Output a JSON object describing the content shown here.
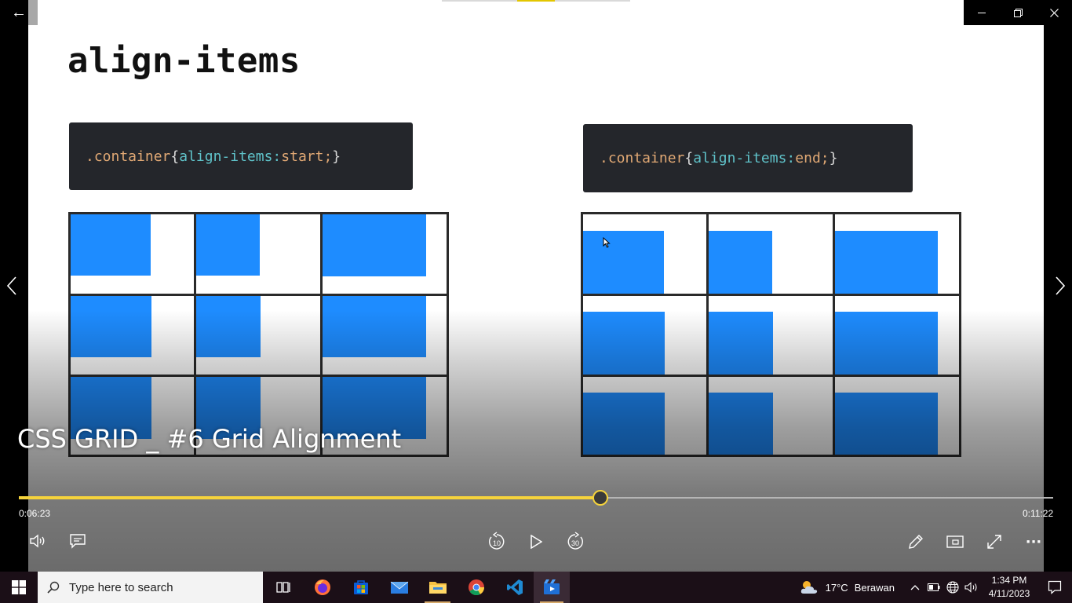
{
  "window": {
    "back_label": "←",
    "minimize_label": "—",
    "restore_label": "❐",
    "close_label": "✕"
  },
  "slide": {
    "title": "align-items",
    "code_left": {
      "selector": ".container",
      "open": "{",
      "property": "align-items:",
      "value": "start;",
      "close": "}"
    },
    "code_right": {
      "selector": ".container",
      "open": "{",
      "property": "align-items:",
      "value": "end;",
      "close": "}"
    }
  },
  "player": {
    "video_title": "CSS GRID _ #6 Grid Alignment",
    "elapsed": "0:06:23",
    "duration": "0:11:22",
    "progress": 0.5625,
    "prev_label": "‹",
    "next_label": "›",
    "rewind_label": "10",
    "forward_label": "30",
    "more_label": "···",
    "accent_color": "#f5d33c"
  },
  "taskbar": {
    "search_placeholder": "Type here to search",
    "icons": [
      "windows-start-icon",
      "task-view-icon",
      "firefox-icon",
      "microsoft-store-icon",
      "mail-icon",
      "file-explorer-icon",
      "chrome-icon",
      "vscode-icon",
      "movies-tv-icon"
    ],
    "weather_temp": "17°C",
    "weather_desc": "Berawan",
    "time": "1:34 PM",
    "date": "4/11/2023",
    "background_color": "#1b0f17"
  }
}
